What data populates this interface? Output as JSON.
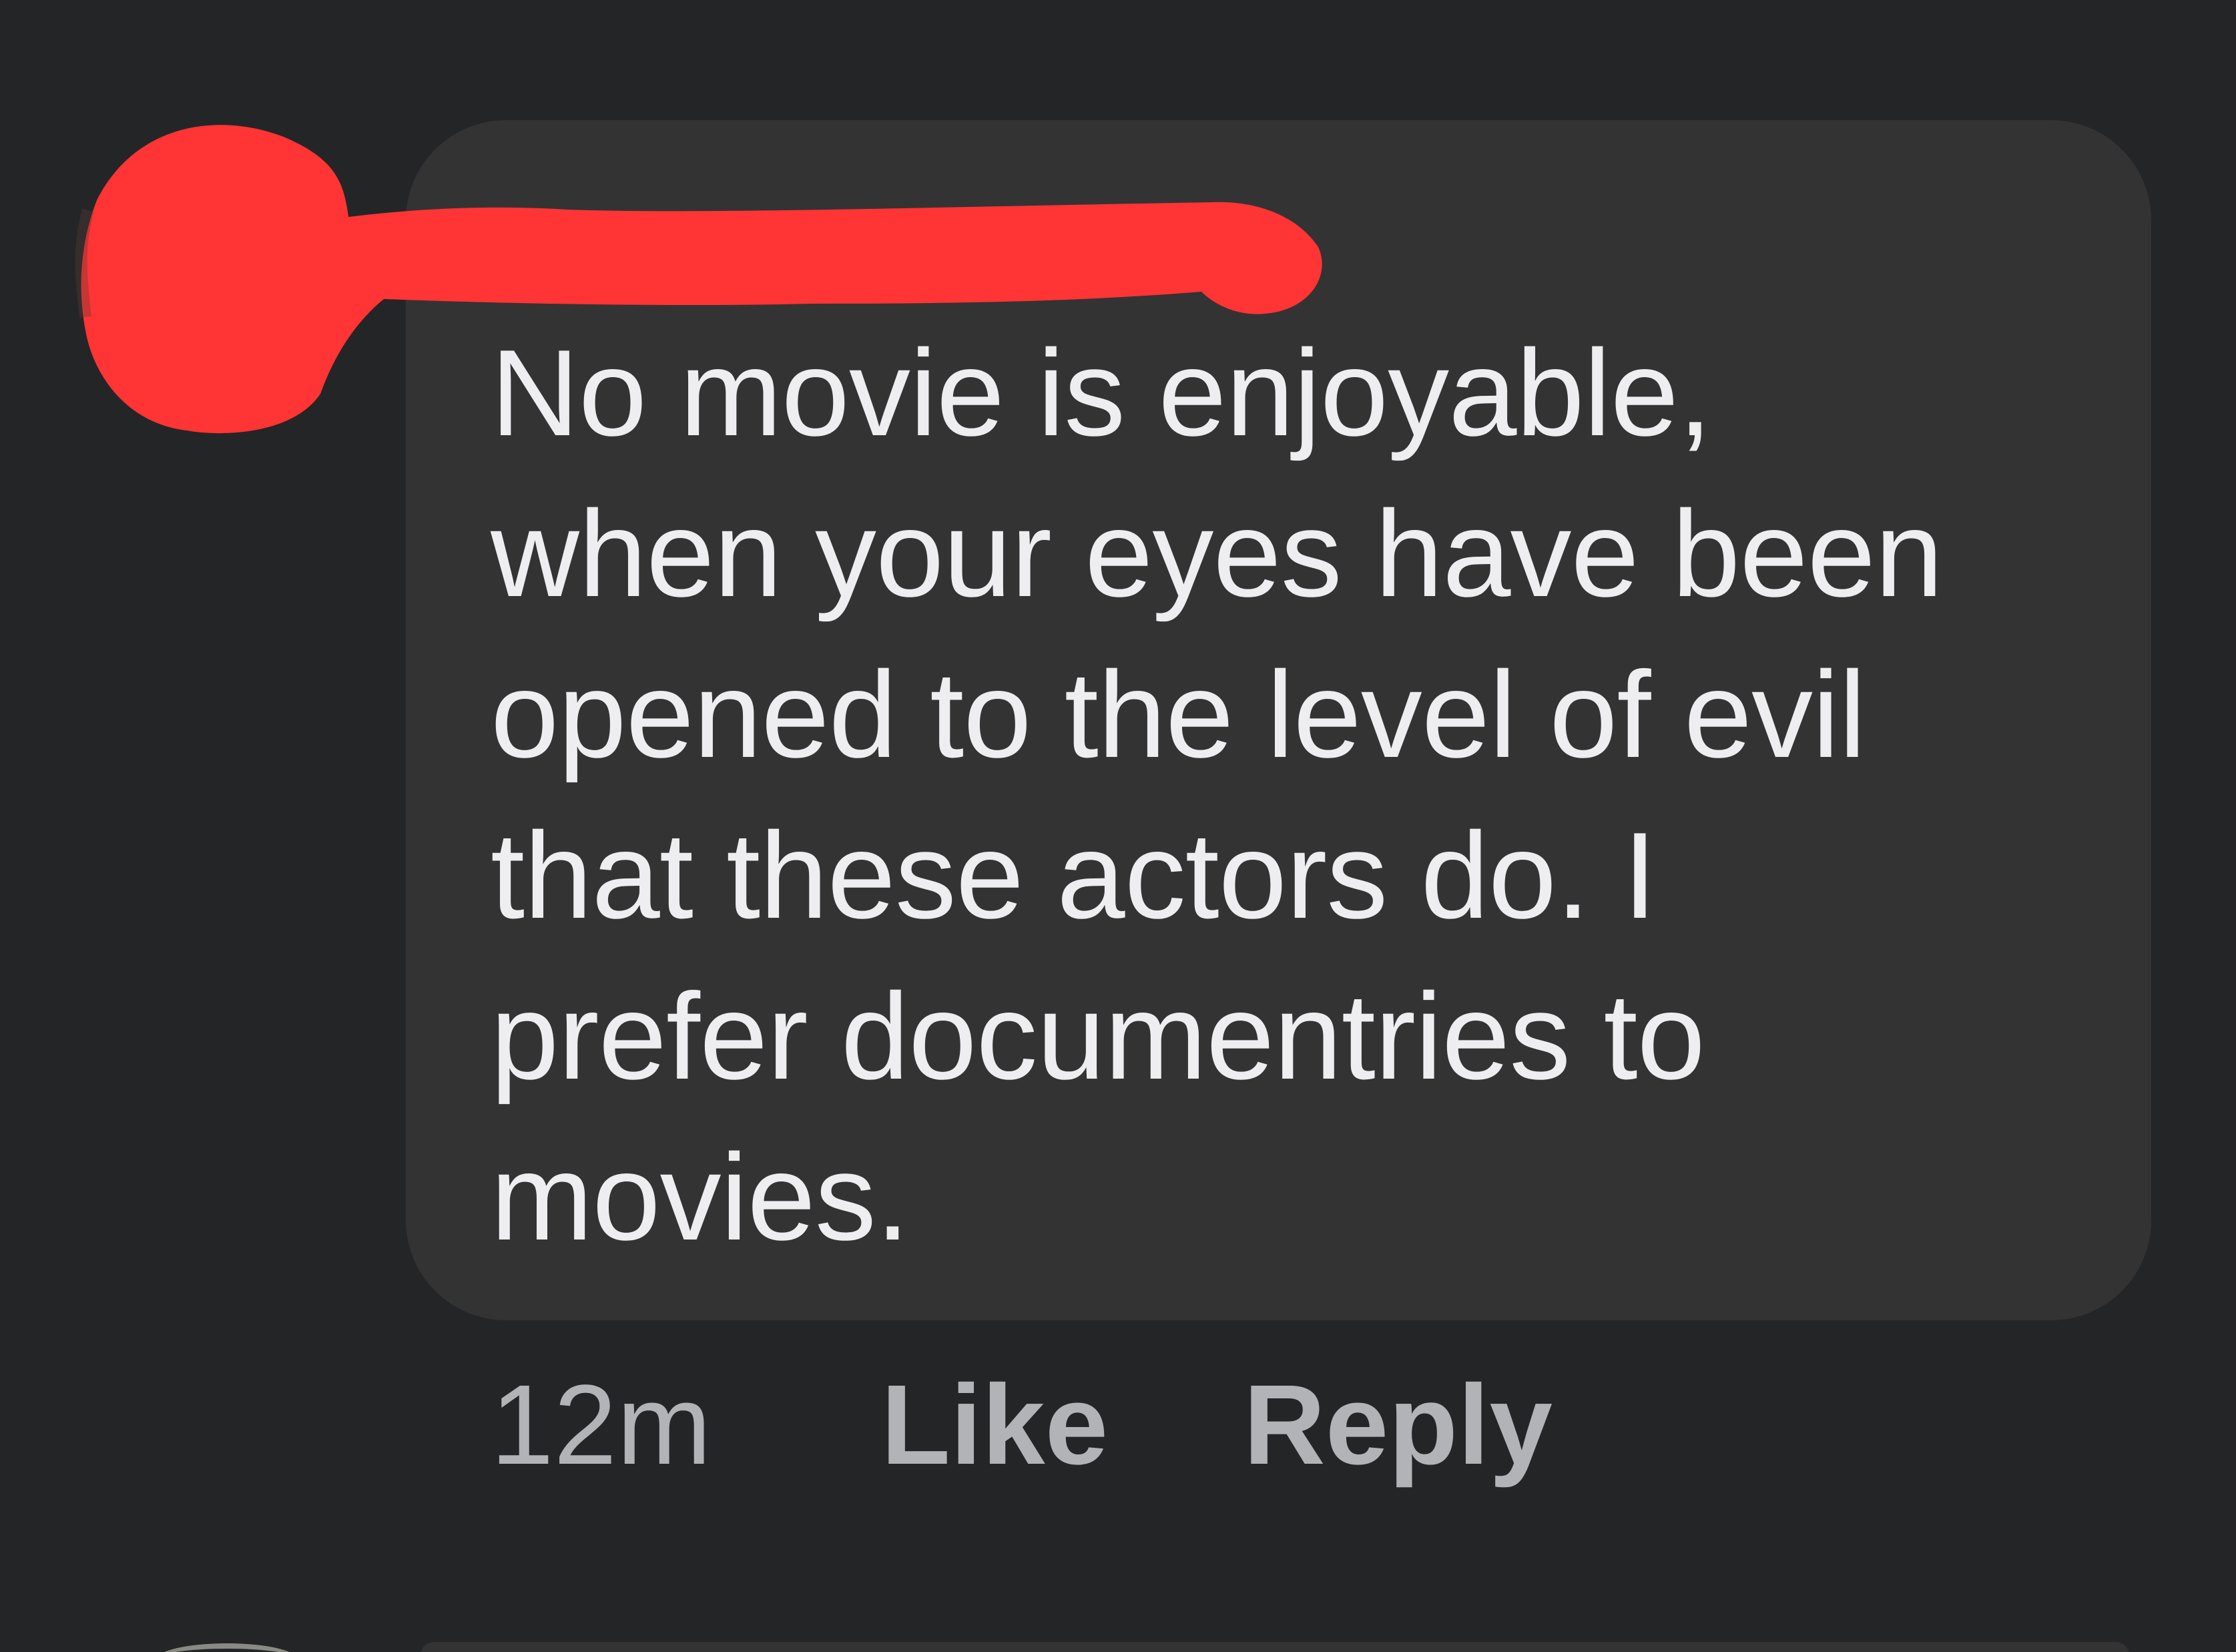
{
  "comment": {
    "text": "No movie is enjoyable,\nwhen your eyes have been\nopened to the level of evil\nthat these actors do. I\nprefer documentries to\nmovies.",
    "timestamp": "12m",
    "like_label": "Like",
    "reply_label": "Reply"
  },
  "colors": {
    "background": "#242527",
    "bubble": "#333334",
    "text": "#eeeef0",
    "meta_text": "#b2b3b7",
    "redaction": "#ff3434"
  },
  "icons": {
    "redaction_mark": "red-scribble-redaction-icon"
  }
}
